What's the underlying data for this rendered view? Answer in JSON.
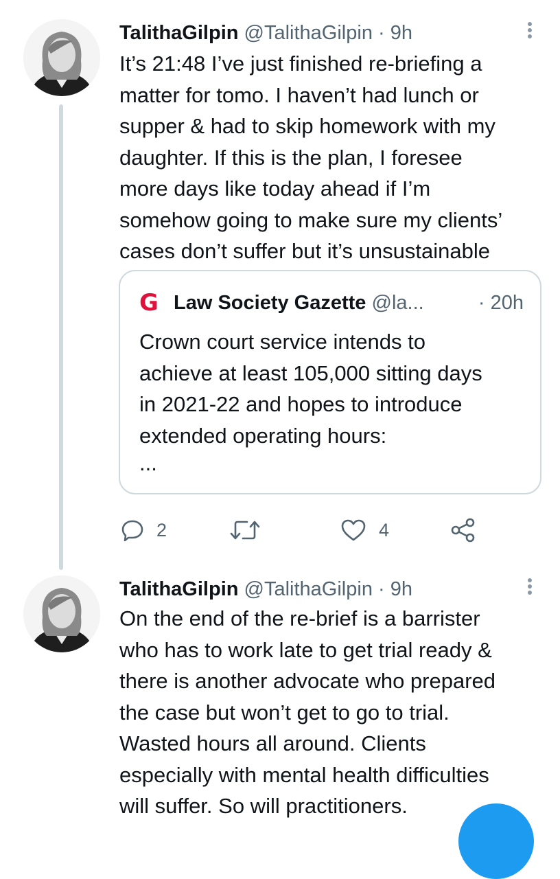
{
  "tweets": [
    {
      "author_name": "TalithaGilpin",
      "author_handle": "@TalithaGilpin",
      "separator": "·",
      "time": "9h",
      "lines": [
        "It’s 21:48 I’ve just finished re-briefing a",
        "matter for tomo. I haven’t had lunch or",
        "supper & had to skip homework with my",
        "daughter. If this is the plan, I foresee",
        "more days like today ahead if I’m",
        "somehow going to make sure my clients’",
        "cases don’t suffer but it’s unsustainable"
      ],
      "quote": {
        "logo_letter": "G",
        "name": "Law Society Gazette",
        "handle": "@la...",
        "time": "· 20h",
        "lines": [
          "Crown court service intends to",
          "achieve at least 105,000 sitting days",
          "in 2021-22 and hopes to introduce",
          "extended operating hours:",
          "..."
        ]
      },
      "actions": {
        "reply_count": "2",
        "retweet_count": "",
        "like_count": "4"
      }
    },
    {
      "author_name": "TalithaGilpin",
      "author_handle": "@TalithaGilpin",
      "separator": "·",
      "time": "9h",
      "lines": [
        "On the end of the re-brief is a barrister",
        "who has to work late to get trial ready &",
        "there is another advocate who prepared",
        "the case but won’t get to go to trial.",
        "Wasted hours all around. Clients",
        "especially with mental health difficulties",
        "will suffer. So will practitioners."
      ]
    }
  ],
  "icons": {
    "more": "more-vertical-icon",
    "reply": "reply-icon",
    "retweet": "retweet-icon",
    "like": "like-icon",
    "share": "share-icon",
    "compose": "compose-fab"
  },
  "colors": {
    "text": "#0f1419",
    "secondary": "#536471",
    "border": "#cfd9de",
    "gazette_red": "#e0113b",
    "accent": "#1d9bf0"
  }
}
